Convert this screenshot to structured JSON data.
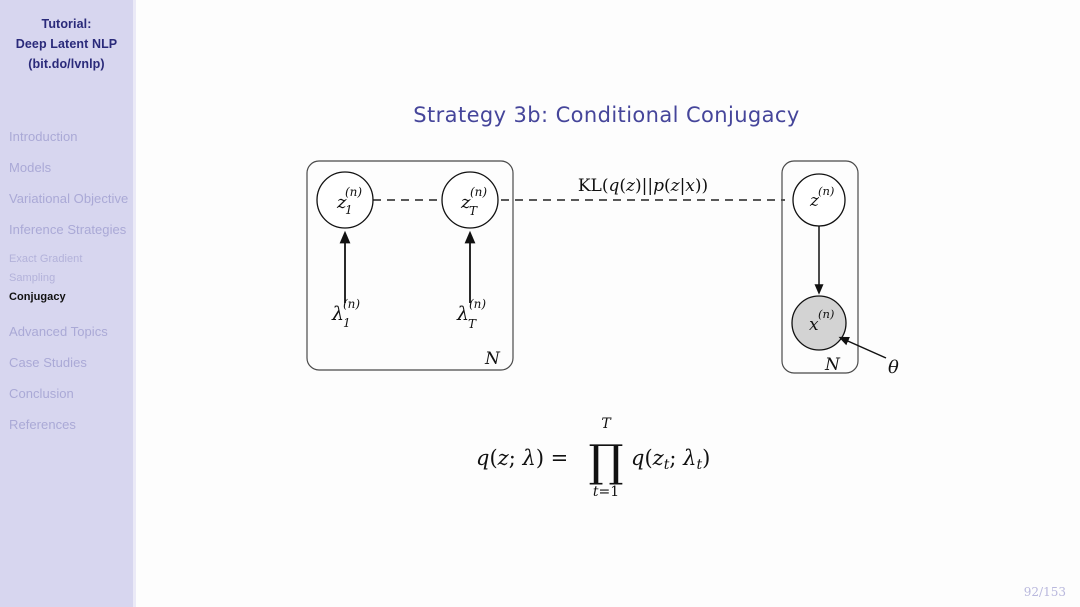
{
  "sidebar": {
    "header_lines": [
      "Tutorial:",
      "Deep Latent NLP",
      "(bit.do/lvnlp)"
    ],
    "sections": [
      {
        "label": "Introduction",
        "active": false
      },
      {
        "label": "Models",
        "active": false
      },
      {
        "label": "Variational Objective",
        "active": false
      },
      {
        "label": "Inference Strategies",
        "active": false
      }
    ],
    "subsections": [
      {
        "label": "Exact Gradient",
        "active": false
      },
      {
        "label": "Sampling",
        "active": false
      },
      {
        "label": "Conjugacy",
        "active": true
      }
    ],
    "sections_after": [
      {
        "label": "Advanced Topics",
        "active": false
      },
      {
        "label": "Case Studies",
        "active": false
      },
      {
        "label": "Conclusion",
        "active": false
      },
      {
        "label": "References",
        "active": false
      }
    ],
    "background_color": "#d7d6ef",
    "header_color": "#2a2a7a",
    "inactive_color": "#aaa9d6",
    "active_color": "#111111"
  },
  "slide": {
    "title": "Strategy 3b: Conditional Conjugacy",
    "title_color": "#45459a",
    "page_number": "92/153"
  },
  "diagram": {
    "left_plate": {
      "plate_label": "N",
      "nodes": [
        {
          "id": "z1",
          "label_base": "z",
          "label_sub": "1",
          "label_sup": "(n)",
          "shaded": false
        },
        {
          "id": "zT",
          "label_base": "z",
          "label_sub": "T",
          "label_sup": "(n)",
          "shaded": false
        }
      ],
      "parameters": [
        {
          "id": "lambda1",
          "label_base": "λ",
          "label_sub": "1",
          "label_sup": "(n)"
        },
        {
          "id": "lambdaT",
          "label_base": "λ",
          "label_sub": "T",
          "label_sup": "(n)"
        }
      ],
      "internal_edge_style": "dashed"
    },
    "right_plate": {
      "plate_label": "N",
      "nodes": [
        {
          "id": "z",
          "label_base": "z",
          "label_sub": "",
          "label_sup": "(n)",
          "shaded": false
        },
        {
          "id": "x",
          "label_base": "x",
          "label_sub": "",
          "label_sup": "(n)",
          "shaded": true
        }
      ],
      "external_parameter": {
        "id": "theta",
        "label": "θ"
      },
      "shaded_node_color": "#d3d3d3"
    },
    "kl_label": {
      "prefix": "KL(",
      "q_part": "q(z)",
      "separator": "||",
      "p_part": "p(z|x)",
      "suffix": ")",
      "full": "KL(q(z)||p(z|x))"
    },
    "formula": {
      "lhs": "q(z; λ) =",
      "product_symbol": "∏",
      "product_upper": "T",
      "product_lower": "t=1",
      "rhs": "q(z_t; λ_t)",
      "full": "q(z; λ) = ∏_{t=1}^{T} q(z_t; λ_t)"
    }
  }
}
